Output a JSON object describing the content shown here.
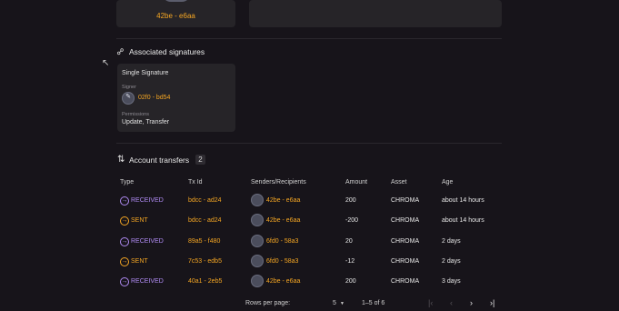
{
  "top_card": {
    "address": "42be - e6aa"
  },
  "signatures": {
    "title": "Associated signatures",
    "card_title": "Single Signature",
    "signer_label": "Signer",
    "signer_value": "02f0 - bd54",
    "permissions_label": "Permissions",
    "permissions_value": "Update, Transfer"
  },
  "transfers": {
    "title": "Account transfers",
    "count": "2",
    "headers": [
      "Type",
      "Tx Id",
      "Senders/Recipients",
      "Amount",
      "Asset",
      "Age"
    ],
    "rows": [
      {
        "type": "RECEIVED",
        "txid": "bdcc - ad24",
        "party": "42be - e6aa",
        "amount": "200",
        "asset": "CHROMA",
        "age": "about 14 hours"
      },
      {
        "type": "SENT",
        "txid": "bdcc - ad24",
        "party": "42be - e6aa",
        "amount": "-200",
        "asset": "CHROMA",
        "age": "about 14 hours"
      },
      {
        "type": "RECEIVED",
        "txid": "89a5 - f480",
        "party": "6fd0 - 58a3",
        "amount": "20",
        "asset": "CHROMA",
        "age": "2 days"
      },
      {
        "type": "SENT",
        "txid": "7c53 - edb5",
        "party": "6fd0 - 58a3",
        "amount": "-12",
        "asset": "CHROMA",
        "age": "2 days"
      },
      {
        "type": "RECEIVED",
        "txid": "40a1 - 2eb5",
        "party": "42be - e6aa",
        "amount": "200",
        "asset": "CHROMA",
        "age": "3 days"
      }
    ]
  },
  "pagination": {
    "rows_per_page_label": "Rows per page:",
    "rows_per_page_value": "5",
    "range": "1–5 of 6"
  },
  "colors": {
    "accent_orange": "#f5a623",
    "received_purple": "#b18cf5",
    "background": "#17141a",
    "card": "#262428"
  },
  "icons": [
    "link-icon",
    "transfer-icon",
    "pen-icon",
    "received-icon",
    "sent-icon",
    "dropdown-icon",
    "first-page-icon",
    "prev-page-icon",
    "next-page-icon",
    "last-page-icon",
    "cursor-icon"
  ]
}
